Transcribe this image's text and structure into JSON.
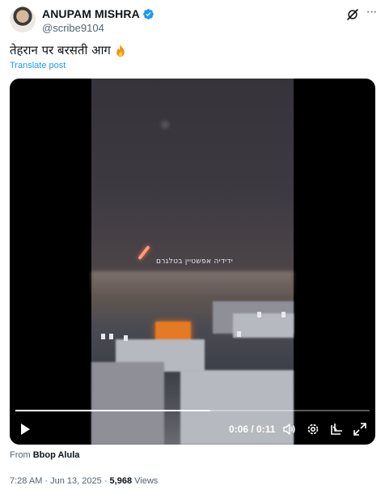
{
  "author": {
    "display_name": "ANUPAM MISHRA",
    "handle": "@scribe9104",
    "verified": true
  },
  "post": {
    "text": "तेहरान पर बरसती आग",
    "emoji_icon": "fire-icon",
    "translate_label": "Translate post"
  },
  "video": {
    "watermark": "ידידיה אפשטיין בטלגרם",
    "current_time": "0:06",
    "separator": " / ",
    "duration": "0:11",
    "progress_fraction": 0.55,
    "controls": [
      "play-icon",
      "volume-icon",
      "settings-icon",
      "pip-icon",
      "fullscreen-icon"
    ]
  },
  "source": {
    "prefix": "From ",
    "name": "Bbop Alula"
  },
  "meta": {
    "time": "7:28 AM",
    "date": "Jun 13, 2025",
    "dot": " · ",
    "views_count": "5,968",
    "views_label": " Views"
  },
  "colors": {
    "accent": "#1d9bf0",
    "text": "#0f1419",
    "muted": "#536471"
  }
}
